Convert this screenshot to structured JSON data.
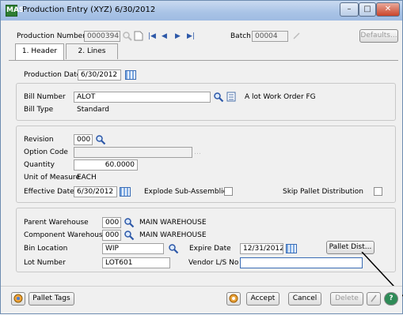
{
  "window": {
    "title": "Production Entry (XYZ) 6/30/2012",
    "app_icon": "MAS"
  },
  "header": {
    "production_number_label": "Production Number",
    "production_number": "0000394",
    "batch_label": "Batch",
    "batch": "00004",
    "defaults_label": "Defaults..."
  },
  "tabs": [
    {
      "label": "1. Header",
      "active": true
    },
    {
      "label": "2. Lines",
      "active": false
    }
  ],
  "form": {
    "production_date_label": "Production Date",
    "production_date": "6/30/2012",
    "bill_number_label": "Bill Number",
    "bill_number": "ALOT",
    "bill_description": "A lot Work Order FG",
    "bill_type_label": "Bill Type",
    "bill_type": "Standard",
    "revision_label": "Revision",
    "revision": "000",
    "option_code_label": "Option Code",
    "option_code": "",
    "quantity_label": "Quantity",
    "quantity": "60.0000",
    "uom_label": "Unit of Measure",
    "uom": "EACH",
    "effective_date_label": "Effective Date",
    "effective_date": "6/30/2012",
    "explode_label": "Explode Sub-Assemblies",
    "skip_pallet_label": "Skip Pallet Distribution",
    "parent_wh_label": "Parent Warehouse",
    "parent_wh": "000",
    "parent_wh_name": "MAIN WAREHOUSE",
    "component_wh_label": "Component Warehouse",
    "component_wh": "000",
    "component_wh_name": "MAIN WAREHOUSE",
    "bin_label": "Bin Location",
    "bin": "WIP",
    "expire_label": "Expire Date",
    "expire_date": "12/31/2012",
    "pallet_dist_label": "Pallet Dist...",
    "lot_label": "Lot Number",
    "lot": "LOT601",
    "vendor_lot_label": "Vendor L/S No",
    "vendor_lot": ""
  },
  "footer": {
    "pallet_tags_label": "Pallet Tags",
    "accept_label": "Accept",
    "cancel_label": "Cancel",
    "delete_label": "Delete"
  }
}
